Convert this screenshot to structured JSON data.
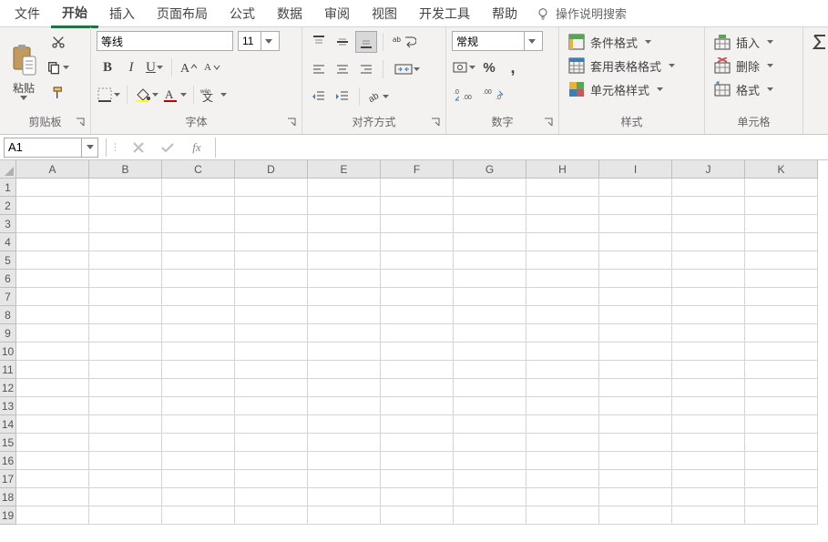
{
  "tabs": {
    "items": [
      "文件",
      "开始",
      "插入",
      "页面布局",
      "公式",
      "数据",
      "审阅",
      "视图",
      "开发工具",
      "帮助"
    ],
    "active_index": 1,
    "tell_me": "操作说明搜索"
  },
  "ribbon": {
    "clipboard": {
      "label": "剪贴板",
      "paste": "粘贴"
    },
    "font": {
      "label": "字体",
      "name": "等线",
      "size": "11",
      "bold": "B",
      "italic": "I",
      "underline": "U",
      "grow": "A",
      "shrink": "A",
      "phonetic": "wén",
      "fontcolor_letter": "A",
      "fill_letter": ""
    },
    "align": {
      "label": "对齐方式",
      "wrap": "ab"
    },
    "number": {
      "label": "数字",
      "format": "常规",
      "percent": "%",
      "comma": ",",
      "inc": ".0 .00",
      "dec": ".00 .0"
    },
    "styles": {
      "label": "样式",
      "cond": "条件格式",
      "table": "套用表格格式",
      "cell": "单元格样式"
    },
    "cells": {
      "label": "单元格",
      "insert": "插入",
      "delete": "删除",
      "format": "格式"
    }
  },
  "formula_bar": {
    "cell_ref": "A1",
    "fx": "fx",
    "value": ""
  },
  "grid": {
    "columns": [
      "A",
      "B",
      "C",
      "D",
      "E",
      "F",
      "G",
      "H",
      "I",
      "J",
      "K"
    ],
    "rows": [
      1,
      2,
      3,
      4,
      5,
      6,
      7,
      8,
      9,
      10,
      11,
      12,
      13,
      14,
      15,
      16,
      17,
      18,
      19
    ]
  }
}
